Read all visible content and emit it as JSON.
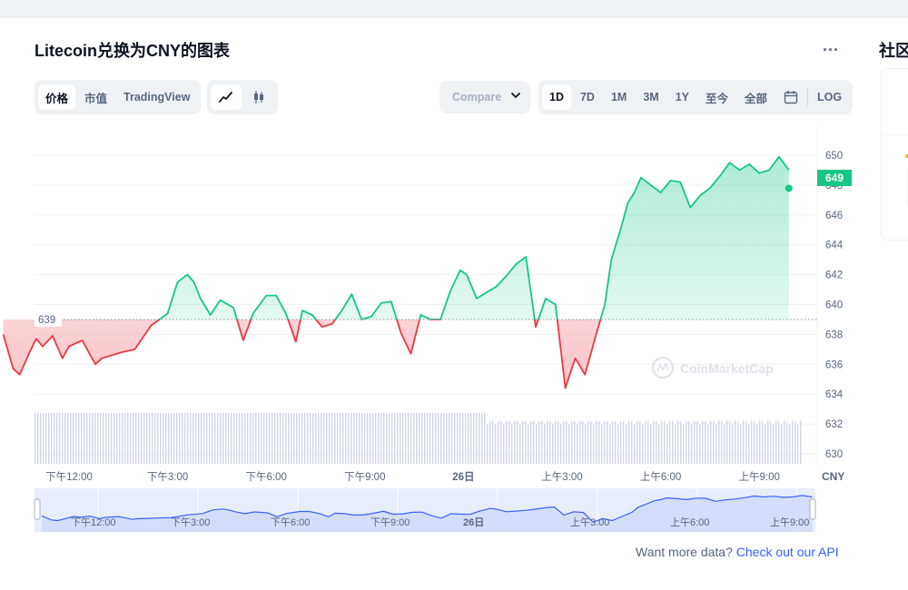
{
  "page": {
    "title": "Litecoin兑换为CNY的图表",
    "side_title": "社区",
    "more_label": "...",
    "footer_text": "Want more data?",
    "footer_link": "Check out our API"
  },
  "tabs_left": [
    {
      "label": "价格",
      "active": true
    },
    {
      "label": "市值",
      "active": false
    },
    {
      "label": "TradingView",
      "active": false
    }
  ],
  "chart_type_icons": [
    {
      "name": "line-chart-icon",
      "active": true
    },
    {
      "name": "candlestick-icon",
      "active": false
    }
  ],
  "compare": {
    "label": "Compare"
  },
  "ranges": [
    {
      "label": "1D",
      "active": true
    },
    {
      "label": "7D",
      "active": false
    },
    {
      "label": "1M",
      "active": false
    },
    {
      "label": "3M",
      "active": false
    },
    {
      "label": "1Y",
      "active": false
    },
    {
      "label": "至今",
      "active": false
    },
    {
      "label": "全部",
      "active": false
    },
    {
      "label": "calendar-icon",
      "icon": true,
      "active": false
    },
    {
      "label": "LOG",
      "active": false
    }
  ],
  "colors": {
    "up": "#16c784",
    "down": "#ea3943",
    "navigator": "#3861fb",
    "grid": "#eff2f5",
    "volume": "#cfd6e4"
  },
  "chart_data": {
    "type": "line",
    "currency": "CNY",
    "watermark": "CoinMarketCap",
    "ylim": [
      629,
      651
    ],
    "yticks": [
      630,
      632,
      634,
      636,
      638,
      640,
      642,
      644,
      646,
      648,
      650
    ],
    "baseline": 639,
    "baseline_label": "639",
    "current_label": "649",
    "xticks": [
      "下午12:00",
      "下午3:00",
      "下午6:00",
      "下午9:00",
      "26日",
      "上午3:00",
      "上午6:00",
      "上午9:00"
    ],
    "xtick_hours": [
      2,
      5,
      8,
      11,
      14,
      17,
      20,
      23
    ],
    "x_hours": [
      0,
      0.3,
      0.5,
      0.8,
      1,
      1.2,
      1.5,
      1.8,
      2,
      2.4,
      2.8,
      3,
      3.3,
      3.6,
      3.8,
      4,
      4.5,
      5,
      5.3,
      5.6,
      5.8,
      6,
      6.3,
      6.6,
      7,
      7.3,
      7.6,
      8,
      8.3,
      8.6,
      8.9,
      9.1,
      9.4,
      9.7,
      10,
      10.3,
      10.6,
      10.9,
      11.2,
      11.5,
      11.8,
      12.1,
      12.4,
      12.7,
      13,
      13.3,
      13.6,
      13.9,
      14.1,
      14.4,
      14.7,
      15,
      15.3,
      15.6,
      15.9,
      16.2,
      16.5,
      16.8,
      17.1,
      17.4,
      17.7,
      18,
      18.3,
      18.5,
      18.8,
      19,
      19.2,
      19.4,
      19.7,
      20,
      20.3,
      20.6,
      20.9,
      21.2,
      21.5,
      21.8,
      22.1,
      22.4,
      22.7,
      23,
      23.3,
      23.6,
      23.9
    ],
    "values": [
      638.0,
      635.7,
      635.3,
      636.8,
      637.7,
      637.2,
      637.9,
      636.4,
      637.2,
      637.6,
      636.0,
      636.4,
      636.6,
      636.8,
      636.9,
      637.0,
      638.6,
      639.4,
      641.5,
      642.0,
      641.5,
      640.4,
      639.3,
      640.3,
      639.8,
      637.6,
      639.4,
      640.6,
      640.6,
      639.4,
      637.5,
      639.6,
      639.3,
      638.5,
      638.7,
      639.6,
      640.7,
      639.0,
      639.2,
      640.1,
      640.2,
      638.1,
      636.7,
      639.3,
      639.0,
      639.0,
      640.9,
      642.3,
      642.0,
      640.4,
      640.8,
      641.2,
      641.9,
      642.7,
      643.2,
      638.5,
      640.4,
      640.0,
      634.4,
      636.4,
      635.3,
      637.7,
      640.0,
      643.0,
      645.2,
      646.8,
      647.5,
      648.5,
      648.0,
      647.5,
      648.3,
      648.2,
      646.5,
      647.3,
      647.8,
      648.6,
      649.5,
      649.0,
      649.4,
      648.8,
      649.0,
      649.9,
      649.0
    ],
    "volume_note": "bars"
  }
}
